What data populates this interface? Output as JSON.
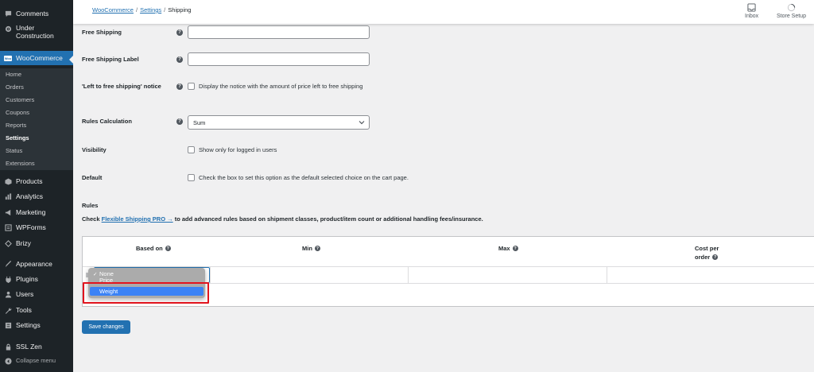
{
  "sidebar": {
    "items": [
      {
        "label": "Comments",
        "icon": "comment-icon"
      },
      {
        "label": "Under\nConstruction",
        "icon": "gear-icon"
      },
      {
        "label": "WooCommerce",
        "icon": "woocommerce-icon"
      },
      {
        "label": "Products",
        "icon": "box-icon"
      },
      {
        "label": "Analytics",
        "icon": "chart-bar-icon"
      },
      {
        "label": "Marketing",
        "icon": "megaphone-icon"
      },
      {
        "label": "WPForms",
        "icon": "form-icon"
      },
      {
        "label": "Brizy",
        "icon": "brizy-icon"
      },
      {
        "label": "Appearance",
        "icon": "brush-icon"
      },
      {
        "label": "Plugins",
        "icon": "plug-icon"
      },
      {
        "label": "Users",
        "icon": "user-icon"
      },
      {
        "label": "Tools",
        "icon": "wrench-icon"
      },
      {
        "label": "Settings",
        "icon": "settings-icon"
      },
      {
        "label": "SSL Zen",
        "icon": "lock-icon"
      },
      {
        "label": "Collapse menu",
        "icon": "collapse-icon"
      }
    ],
    "woo_badge": "Woo",
    "submenu": [
      "Home",
      "Orders",
      "Customers",
      "Coupons",
      "Reports",
      "Settings",
      "Status",
      "Extensions"
    ],
    "accent_color": "#2271b1"
  },
  "header": {
    "breadcrumb": [
      "WooCommerce",
      "Settings",
      "Shipping"
    ],
    "separator": "/",
    "inbox_label": "Inbox",
    "store_setup_label": "Store Setup"
  },
  "form": {
    "free_shipping_label": "Free Shipping",
    "free_shipping_value": "",
    "free_shipping_label_label": "Free Shipping Label",
    "free_shipping_label_value": "",
    "left_notice_label": "'Left to free shipping' notice",
    "left_notice_text": "Display the notice with the amount of price left to free shipping",
    "rules_calc_label": "Rules Calculation",
    "rules_calc_value": "Sum",
    "visibility_label": "Visibility",
    "visibility_text": "Show only for logged in users",
    "default_label": "Default",
    "default_text": "Check the box to set this option as the default selected choice on the cart page.",
    "help_glyph": "?"
  },
  "rules": {
    "title": "Rules",
    "desc_prefix": "Check",
    "desc_link": "Flexible Shipping PRO →",
    "desc_suffix": "to add advanced rules based on shipment classes, product/item count or additional handling fees/insurance.",
    "columns": {
      "based_on": "Based on",
      "min": "Min",
      "max": "Max",
      "cost_line1": "Cost per",
      "cost_line2": "order"
    },
    "dropdown": {
      "options": [
        "None",
        "Price",
        "Weight"
      ],
      "checked": "✓",
      "checked_index": 0,
      "highlighted_index": 2
    }
  },
  "actions": {
    "save_label": "Save changes"
  }
}
